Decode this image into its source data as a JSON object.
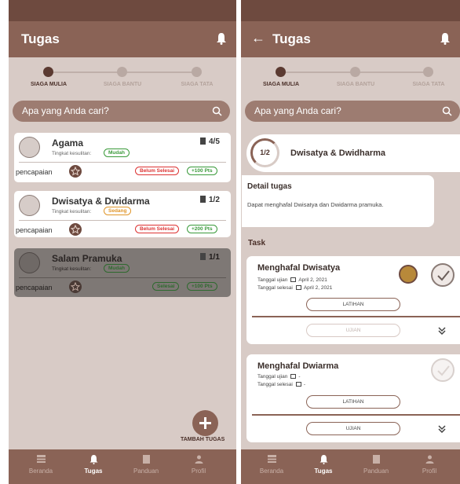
{
  "left": {
    "header": {
      "title": "Tugas"
    },
    "stepper": [
      "SIAGA MULIA",
      "SIAGA BANTU",
      "SIAGA TATA"
    ],
    "search": {
      "placeholder": "Apa yang Anda cari?"
    },
    "cards": [
      {
        "title": "Agama",
        "difficulty_label": "Tingkat kesulitan:",
        "difficulty": "Mudah",
        "count": "4/5",
        "achievement_label": "pencapaian",
        "status": "Belum Selesai",
        "points": "+100 Pts"
      },
      {
        "title": "Dwisatya & Dwidarma",
        "difficulty_label": "Tingkat kesulitan:",
        "difficulty": "Sedang",
        "count": "1/2",
        "achievement_label": "pencapaian",
        "status": "Belum Selesai",
        "points": "+200 Pts"
      },
      {
        "title": "Salam Pramuka",
        "difficulty_label": "Tingkat kesulitan:",
        "difficulty": "Mudah",
        "count": "1/1",
        "achievement_label": "pencapaian",
        "status": "Selesai",
        "points": "+100 Pts"
      }
    ],
    "fab_label": "TAMBAH TUGAS"
  },
  "right": {
    "header": {
      "title": "Tugas"
    },
    "stepper": [
      "SIAGA MULIA",
      "SIAGA BANTU",
      "SIAGA TATA"
    ],
    "search": {
      "placeholder": "Apa yang Anda cari?"
    },
    "progress": "1/2",
    "task_title": "Dwisatya & Dwidharma",
    "detail_title": "Detail tugas",
    "detail_text": "Dapat menghafal Dwisatya dan Dwidarma pramuka.",
    "task_section": "Task",
    "tasks": [
      {
        "title": "Menghafal Dwisatya",
        "exam_label": "Tanggal ujian",
        "exam_date": "April 2, 2021",
        "done_label": "Tanggal selesai",
        "done_date": "April 2, 2021",
        "practice": "LATIHAN",
        "exam": "UJIAN"
      },
      {
        "title": "Menghafal Dwiarma",
        "exam_label": "Tanggal ujian",
        "exam_date": "-",
        "done_label": "Tanggal selesai",
        "done_date": "-",
        "practice": "LATIHAN",
        "exam": "UJIAN"
      }
    ]
  },
  "nav": [
    "Beranda",
    "Tugas",
    "Panduan",
    "Profil"
  ],
  "colors": {
    "primary": "#8a6356",
    "dark": "#6e4a3f",
    "background": "#d8cbc6"
  }
}
